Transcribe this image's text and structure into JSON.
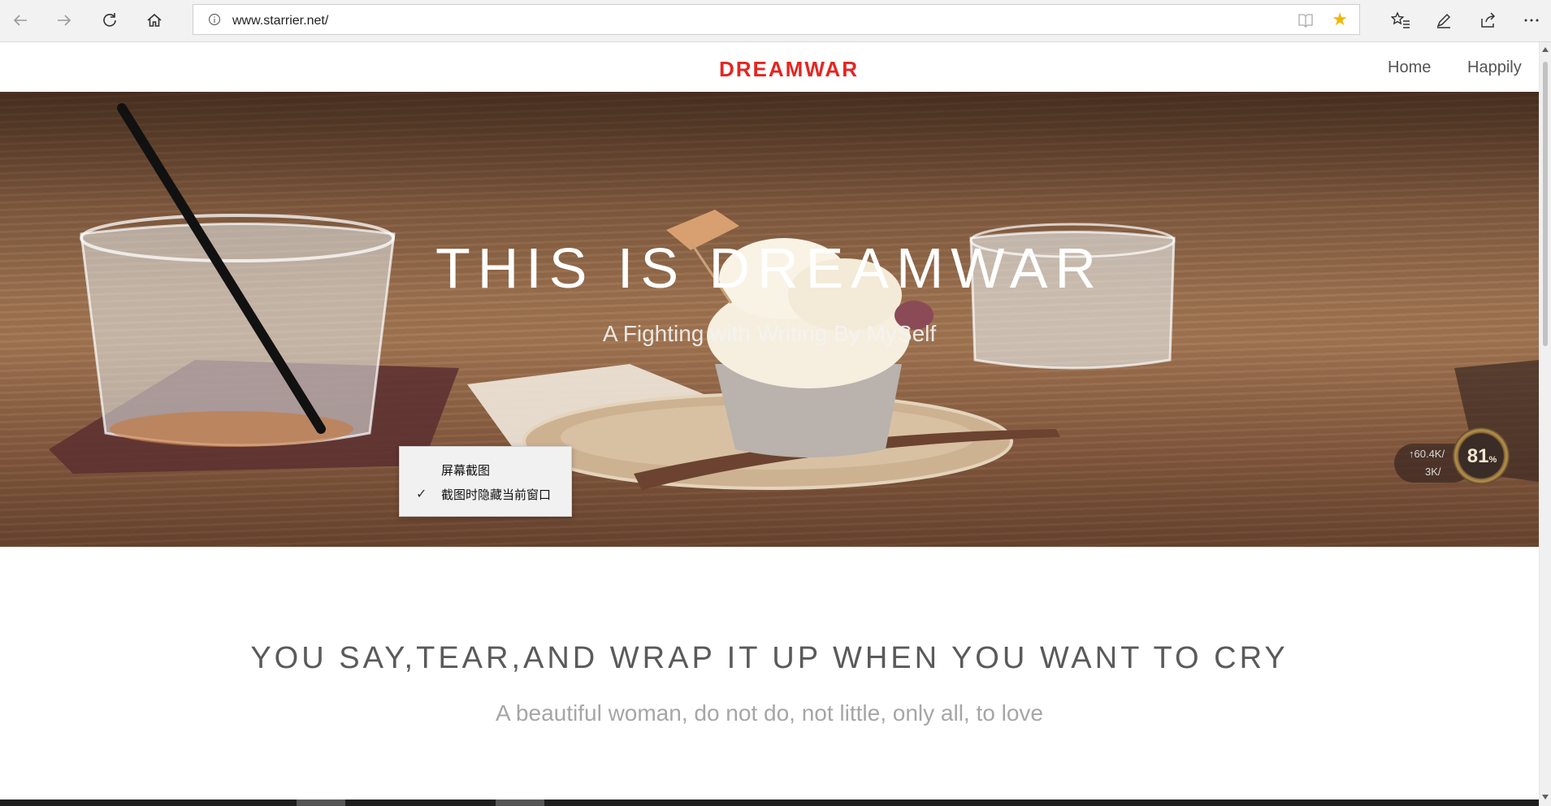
{
  "browser": {
    "url": "www.starrier.net/",
    "icons": [
      "back-arrow-icon",
      "forward-arrow-icon",
      "refresh-icon",
      "home-icon",
      "info-icon",
      "reading-view-icon",
      "favorite-star-icon",
      "favorites-list-icon",
      "pen-notes-icon",
      "share-icon",
      "more-menu-icon"
    ],
    "favorite_color": "#f2b600"
  },
  "site": {
    "brand": "DREAMWAR",
    "brand_color": "#e52521",
    "nav": [
      {
        "label": "Home"
      },
      {
        "label": "Happily"
      }
    ]
  },
  "hero": {
    "title": "THIS IS DREAMWAR",
    "subtitle": "A Fighting with Writing By MySelf"
  },
  "context_menu": {
    "items": [
      {
        "label": "屏幕截图",
        "checked": false
      },
      {
        "label": "截图时隐藏当前窗口",
        "checked": true
      }
    ],
    "check_glyph": "✓"
  },
  "net_widget": {
    "upload": "↑60.4K/",
    "download": "3K/",
    "percent": "81",
    "percent_unit": "%"
  },
  "section": {
    "title": "YOU SAY,TEAR,AND WRAP IT UP WHEN YOU WANT TO CRY",
    "subtitle": "A beautiful woman, do not do, not little, only all, to love"
  }
}
